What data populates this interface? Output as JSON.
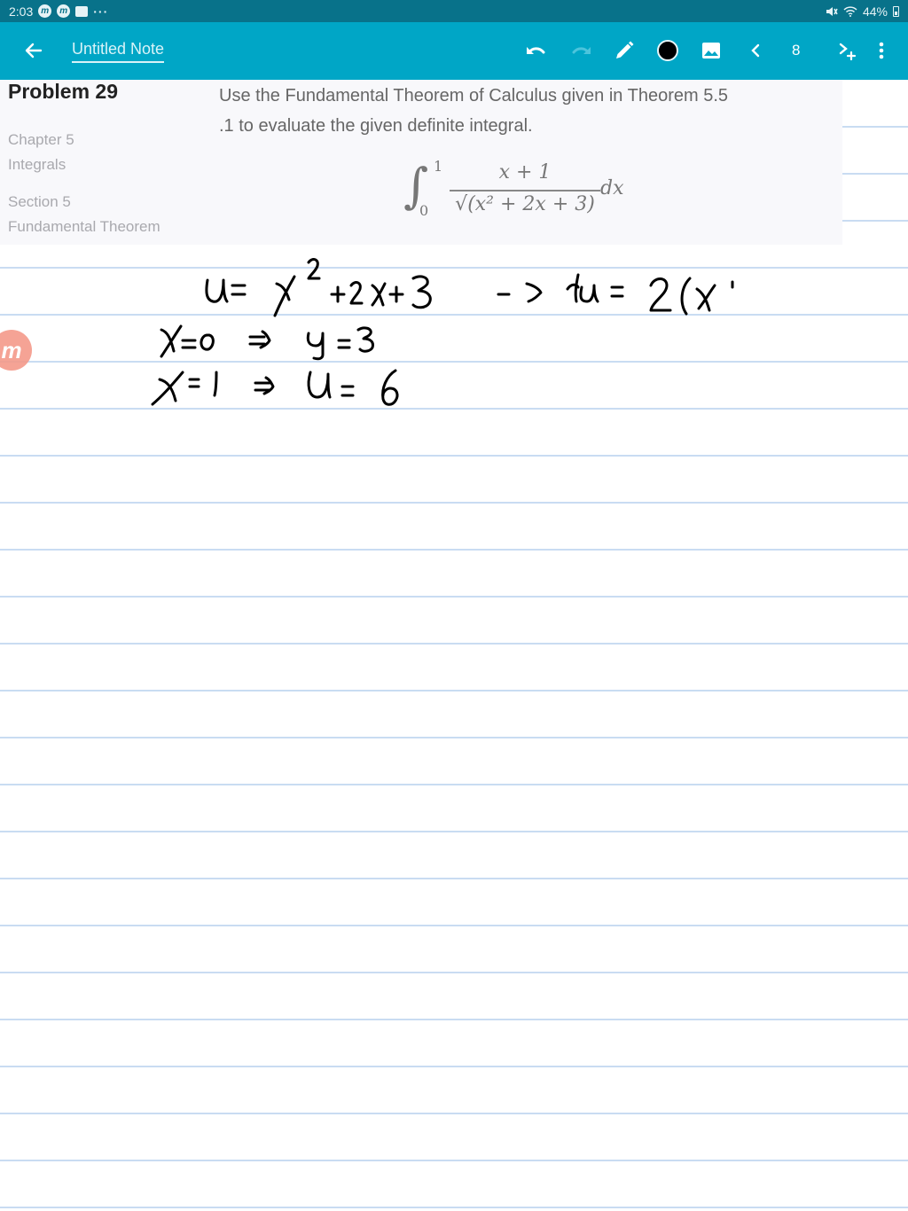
{
  "status_bar": {
    "time": "2:03",
    "left_icons": [
      "app-notification-icon",
      "app-notification-icon",
      "gallery-notification-icon",
      "more-notifications-icon"
    ],
    "more": "···",
    "right_icons": [
      "mute-icon",
      "wifi-icon",
      "battery-icon"
    ],
    "battery": "44%"
  },
  "toolbar": {
    "title": "Untitled Note",
    "page_number": "8",
    "pen_color": "#000000",
    "accent": "#00a6c6"
  },
  "problem": {
    "title": "Problem 29",
    "chapter_label": "Chapter 5",
    "chapter_name": "Integrals",
    "section_label": "Section 5",
    "section_name": "Fundamental Theorem",
    "statement_line1": "Use the Fundamental Theorem of Calculus given in Theorem 5.5",
    "statement_line2": ".1 to evaluate the given definite integral.",
    "formula": {
      "sign": "∫",
      "upper": "1",
      "lower": "0",
      "numerator": "x + 1",
      "denominator": "√(x² + 2x + 3)",
      "differential": "dx"
    }
  },
  "handwriting": {
    "line1": "u = x² + 2x + 3 => du = 2(x",
    "line2": "x = 0 => u = 3",
    "line3": "x = 1 => u = 6"
  },
  "recorder_badge": {
    "glyph": "m"
  }
}
